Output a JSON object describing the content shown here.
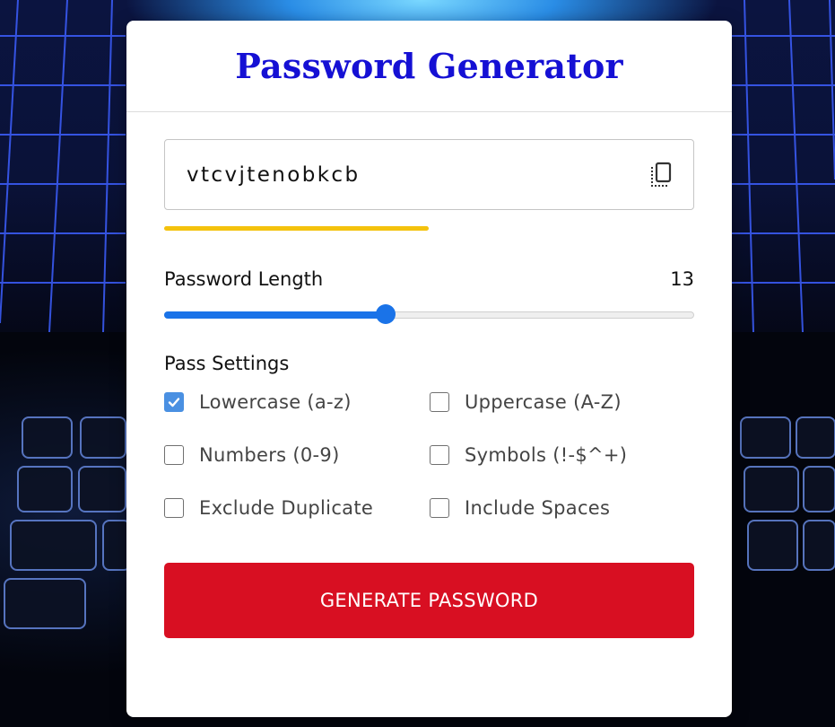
{
  "app": {
    "title": "Password Generator"
  },
  "password": {
    "value": "vtcvjtenobkcb",
    "strength_fraction": 0.5
  },
  "length": {
    "label": "Password Length",
    "value": "13",
    "slider_fraction": 0.42
  },
  "settings": {
    "label": "Pass Settings",
    "options": [
      {
        "label": "Lowercase (a-z)",
        "checked": true
      },
      {
        "label": "Uppercase (A-Z)",
        "checked": false
      },
      {
        "label": "Numbers (0-9)",
        "checked": false
      },
      {
        "label": "Symbols (!-$^+)",
        "checked": false
      },
      {
        "label": "Exclude Duplicate",
        "checked": false
      },
      {
        "label": "Include Spaces",
        "checked": false
      }
    ]
  },
  "generate_button": {
    "label": "GENERATE PASSWORD"
  },
  "icons": {
    "copy": "copy-icon",
    "check": "check-icon"
  },
  "colors": {
    "title": "#1510d4",
    "accent": "#1a73e8",
    "checkbox_checked": "#4a90e2",
    "strength": "#f4c20d",
    "button": "#d80f22"
  }
}
